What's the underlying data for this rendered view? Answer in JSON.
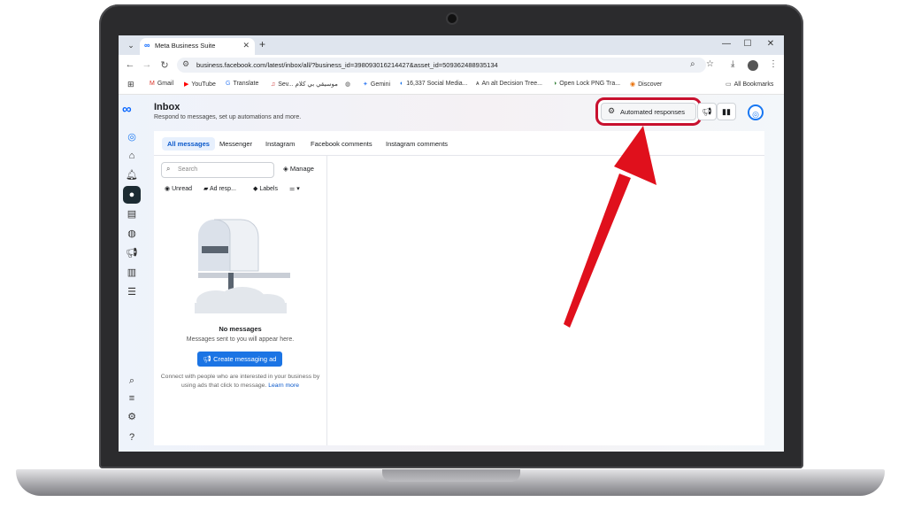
{
  "browser": {
    "tab_title": "Meta Business Suite",
    "url": "business.facebook.com/latest/inbox/all/?business_id=398093016214427&asset_id=509362488935134",
    "bookmarks": [
      {
        "label": "Gmail",
        "icon": "M"
      },
      {
        "label": "YouTube",
        "icon": "▶"
      },
      {
        "label": "Translate",
        "icon": "G"
      },
      {
        "label": "Sev... موسيقي بي كلام",
        "icon": "♫"
      },
      {
        "label": "",
        "icon": "◍"
      },
      {
        "label": "Gemini",
        "icon": "✦"
      },
      {
        "label": "16,337 Social Media...",
        "icon": "◐"
      },
      {
        "label": "An alt Decision Tree...",
        "icon": "ᴀ"
      },
      {
        "label": "Open Lock PNG Tra...",
        "icon": "◑"
      },
      {
        "label": "Discover",
        "icon": "◉"
      }
    ],
    "all_bookmarks": "All Bookmarks"
  },
  "header": {
    "title": "Inbox",
    "subtitle": "Respond to messages, set up automations and more.",
    "automated_responses": "Automated responses"
  },
  "tabs": [
    "All messages",
    "Messenger",
    "Instagram",
    "Facebook comments",
    "Instagram comments"
  ],
  "list": {
    "search_placeholder": "Search",
    "manage": "Manage",
    "filters": [
      "Unread",
      "Ad resp...",
      "Labels"
    ],
    "empty_title": "No messages",
    "empty_sub": "Messages sent to you will appear here.",
    "create_button": "Create messaging ad",
    "connect_text": "Connect with people who are interested in your business by using ads that click to message.",
    "learn_more": "Learn more"
  },
  "colors": {
    "accent": "#1b74e4",
    "highlight": "#c8102e"
  }
}
